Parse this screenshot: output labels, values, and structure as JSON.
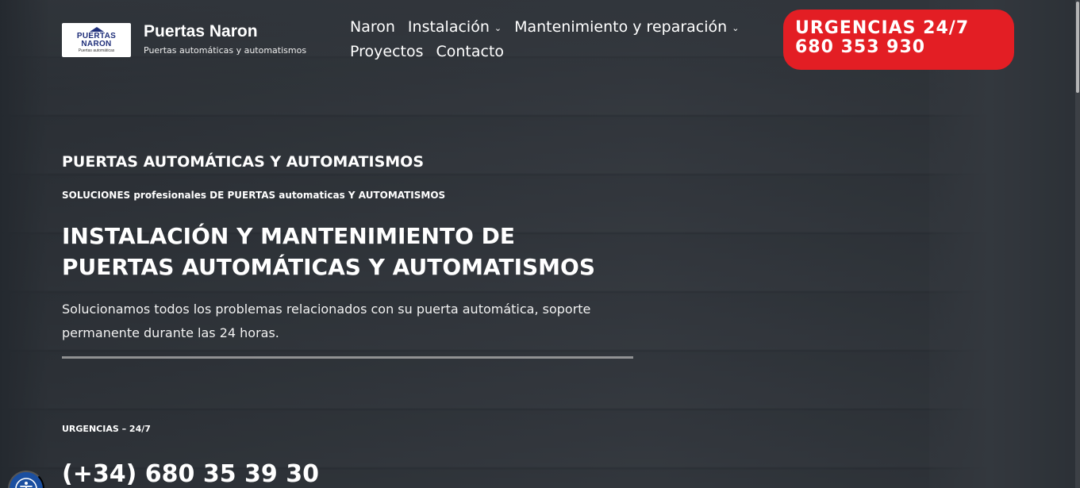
{
  "header": {
    "logo": {
      "line1": "PUERTAS",
      "line2": "NARON",
      "line3": "Puertas automáticas"
    },
    "brand_title": "Puertas Naron",
    "brand_tagline": "Puertas automáticas y automatismos",
    "nav": [
      {
        "label": "Naron",
        "has_dropdown": false
      },
      {
        "label": "Instalación",
        "has_dropdown": true
      },
      {
        "label": "Mantenimiento y reparación",
        "has_dropdown": true
      },
      {
        "label": "Proyectos",
        "has_dropdown": false
      },
      {
        "label": "Contacto",
        "has_dropdown": false
      }
    ],
    "cta": {
      "line1": "URGENCIAS 24/7",
      "line2": "680 353 930"
    }
  },
  "hero": {
    "eyebrow": "PUERTAS AUTOMÁTICAS Y AUTOMATISMOS",
    "sub_eyebrow": "SOLUCIONES profesionales DE PUERTAS automaticas Y AUTOMATISMOS",
    "headline_line1": "INSTALACIÓN Y MANTENIMIENTO DE",
    "headline_line2": "PUERTAS AUTOMÁTICAS Y AUTOMATISMOS",
    "lead": "Solucionamos todos los problemas relacionados con su puerta automática, soporte permanente durante las 24 horas.",
    "urgent_label": "URGENCIAS – 24/7",
    "phone": "(+34) 680 35 39 30"
  },
  "colors": {
    "cta_background": "#e31e24",
    "logo_text": "#1f2f7a",
    "accessibility_button": "#1b4fa0"
  },
  "icons": {
    "dropdown": "chevron-down-icon",
    "accessibility": "accessibility-icon"
  }
}
